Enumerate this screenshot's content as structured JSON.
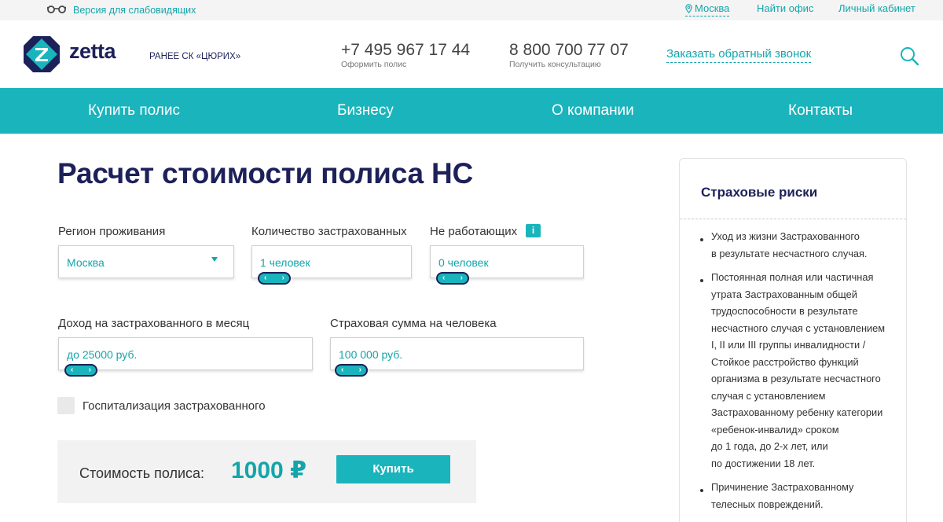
{
  "topbar": {
    "vision_label": "Версия для слабовидящих",
    "city": "Москва",
    "find_office": "Найти офис",
    "personal_cabinet": "Личный кабинет"
  },
  "header": {
    "logo_text": "zetta",
    "formerly": "РАНЕЕ СК «ЦЮРИХ»",
    "phone1": {
      "number": "+7 495 967 17 44",
      "caption": "Оформить полис"
    },
    "phone2": {
      "number": "8 800 700 77 07",
      "caption": "Получить консультацию"
    },
    "callback": "Заказать обратный звонок"
  },
  "nav": {
    "items": [
      "Купить полис",
      "Бизнесу",
      "О компании",
      "Контакты"
    ]
  },
  "calculator": {
    "title": "Расчет стоимости полиса НС",
    "region": {
      "label": "Регион проживания",
      "value": "Москва"
    },
    "insured_count": {
      "label": "Количество застрахованных",
      "value": "1 человек"
    },
    "non_working": {
      "label": "Не работающих",
      "value": "0 человек",
      "info": "i"
    },
    "income": {
      "label": "Доход на застрахованного в месяц",
      "value": "до 25000 руб."
    },
    "sum_insured": {
      "label": "Страховая сумма на человека",
      "value": "100 000 руб."
    },
    "hospitalization": {
      "label": "Госпитализация застрахованного",
      "checked": false
    },
    "price": {
      "label": "Стоимость полиса:",
      "value": "1000 ₽"
    },
    "buy_button": "Купить"
  },
  "risks": {
    "title": "Страховые риски",
    "items": [
      [
        "Уход из жизни Застрахованного",
        "в результате несчастного случая."
      ],
      [
        "Постоянная полная или частичная",
        "утрата Застрахованным общей",
        "трудоспособности в результате",
        "несчастного случая с установлением",
        "I, II или III группы инвалидности /",
        "Стойкое расстройство функций",
        "организма в результате несчастного",
        "случая с установлением",
        "Застрахованному ребенку категории",
        "«ребенок-инвалид» сроком",
        "до 1 года, до 2-х лет, или",
        "по достижении 18 лет."
      ],
      [
        "Причинение Застрахованному",
        "телесных повреждений."
      ]
    ]
  },
  "colors": {
    "accent": "#19b4bc",
    "brand_dark": "#1d2159",
    "link": "#13a5ab"
  }
}
